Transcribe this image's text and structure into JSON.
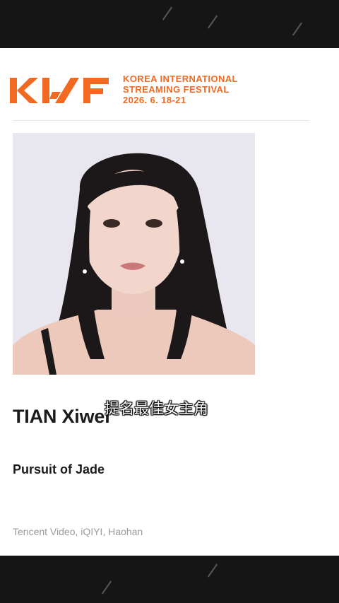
{
  "logo": {
    "mark": "KISF",
    "line1": "KOREA INTERNATIONAL",
    "line2": "STREAMING FESTIVAL",
    "dates": "2026. 6. 18-21",
    "color": "#f26a22"
  },
  "nominee": {
    "name": "TIAN Xiwei",
    "work": "Pursuit of Jade",
    "platforms": "Tencent Video, iQIYI, Haohan"
  },
  "caption": "提名最佳女主角"
}
